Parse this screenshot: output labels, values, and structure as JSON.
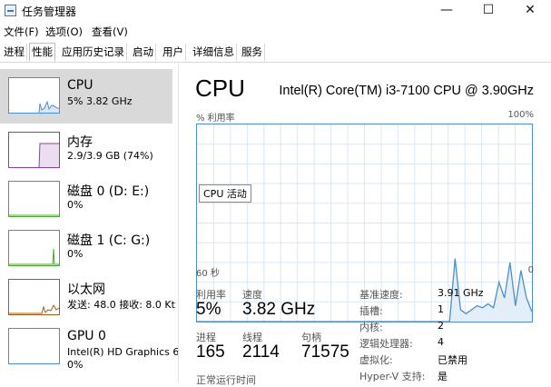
{
  "window": {
    "title": "任务管理器",
    "minimize": "—",
    "maximize": "☐",
    "close": "✕"
  },
  "menu": [
    "文件(F)",
    "选项(O)",
    "查看(V)"
  ],
  "tabs": [
    "进程",
    "性能",
    "应用历史记录",
    "启动",
    "用户",
    "详细信息",
    "服务"
  ],
  "active_tab": "性能",
  "devices": [
    {
      "name": "CPU",
      "sub": "5% 3.82 GHz",
      "sub2": ""
    },
    {
      "name": "内存",
      "sub": "2.9/3.9 GB (74%)",
      "sub2": ""
    },
    {
      "name": "磁盘 0 (D: E:)",
      "sub": "0%",
      "sub2": ""
    },
    {
      "name": "磁盘 1 (C: G:)",
      "sub": "0%",
      "sub2": ""
    },
    {
      "name": "以太网",
      "sub": "发送: 48.0 接收: 8.0 Kt",
      "sub2": ""
    },
    {
      "name": "GPU 0",
      "sub": "Intel(R) HD Graphics 6",
      "sub2": "0%"
    }
  ],
  "colors": {
    "cpu": "#4b8fcf",
    "memory": "#8b3fa3",
    "disk": "#4ea72e",
    "ethernet": "#a65c16",
    "gpu": "#4b8fcf"
  },
  "main": {
    "title": "CPU",
    "model": "Intel(R) Core(TM) i3-7100 CPU @ 3.90GHz",
    "axis_top_left": "% 利用率",
    "axis_top_right": "100%",
    "axis_bottom_left": "60 秒",
    "axis_bottom_right": "0",
    "activity_label": "CPU 活动"
  },
  "chart_data": {
    "type": "area",
    "title": "",
    "xlabel": "60 秒",
    "ylabel": "% 利用率",
    "ylim": [
      0,
      100
    ],
    "xlim": [
      60,
      0
    ],
    "series": [
      {
        "name": "CPU 活动",
        "values": [
          0,
          0,
          0,
          0,
          0,
          0,
          0,
          0,
          0,
          0,
          0,
          0,
          0,
          0,
          0,
          0,
          0,
          0,
          0,
          0,
          0,
          0,
          0,
          0,
          0,
          0,
          0,
          0,
          0,
          0,
          0,
          0,
          0,
          0,
          0,
          0,
          0,
          0,
          0,
          0,
          0,
          0,
          0,
          0,
          0,
          0,
          0,
          32,
          6,
          4,
          6,
          8,
          7,
          9,
          7,
          20,
          12,
          30,
          8,
          26,
          12,
          5
        ]
      }
    ]
  },
  "stats": [
    {
      "label": "利用率",
      "value": "5%"
    },
    {
      "label": "速度",
      "value": "3.82 GHz"
    },
    {
      "label": "进程",
      "value": "165"
    },
    {
      "label": "线程",
      "value": "2114"
    },
    {
      "label": "句柄",
      "value": "71575"
    },
    {
      "label": "正常运行时间",
      "value": ""
    }
  ],
  "info": [
    {
      "label": "基准速度:",
      "value": "3.91 GHz"
    },
    {
      "label": "插槽:",
      "value": "1"
    },
    {
      "label": "内核:",
      "value": "2"
    },
    {
      "label": "逻辑处理器:",
      "value": "4"
    },
    {
      "label": "虚拟化:",
      "value": "已禁用"
    },
    {
      "label": "Hyper-V 支持:",
      "value": "是"
    }
  ]
}
